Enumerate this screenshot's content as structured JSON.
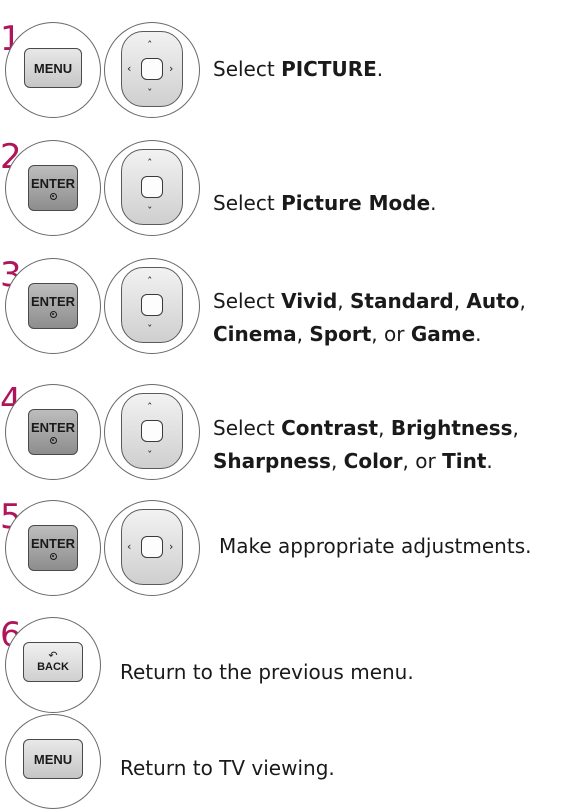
{
  "steps": [
    {
      "number": "1",
      "button": "MENU",
      "nav_arrows": [
        "up",
        "down",
        "left",
        "right"
      ],
      "text": [
        {
          "t": "Select "
        },
        {
          "t": "PICTURE",
          "b": true
        },
        {
          "t": "."
        }
      ]
    },
    {
      "number": "2",
      "button": "ENTER",
      "nav_arrows": [
        "up",
        "down"
      ],
      "text": [
        {
          "t": "Select "
        },
        {
          "t": "Picture Mode",
          "b": true
        },
        {
          "t": "."
        }
      ]
    },
    {
      "number": "3",
      "button": "ENTER",
      "nav_arrows": [
        "up",
        "down"
      ],
      "lines": [
        [
          {
            "t": "Select "
          },
          {
            "t": "Vivid",
            "b": true
          },
          {
            "t": ", "
          },
          {
            "t": "Standard",
            "b": true
          },
          {
            "t": ", "
          },
          {
            "t": "Auto",
            "b": true
          },
          {
            "t": ","
          }
        ],
        [
          {
            "t": "Cinema",
            "b": true
          },
          {
            "t": ", "
          },
          {
            "t": "Sport",
            "b": true
          },
          {
            "t": ", or "
          },
          {
            "t": "Game",
            "b": true
          },
          {
            "t": "."
          }
        ]
      ]
    },
    {
      "number": "4",
      "button": "ENTER",
      "nav_arrows": [
        "up",
        "down"
      ],
      "lines": [
        [
          {
            "t": "Select "
          },
          {
            "t": "Contrast",
            "b": true
          },
          {
            "t": ", "
          },
          {
            "t": "Brightness",
            "b": true
          },
          {
            "t": ","
          }
        ],
        [
          {
            "t": "Sharpness",
            "b": true
          },
          {
            "t": ", "
          },
          {
            "t": "Color",
            "b": true
          },
          {
            "t": ", or "
          },
          {
            "t": "Tint",
            "b": true
          },
          {
            "t": "."
          }
        ]
      ]
    },
    {
      "number": "5",
      "button": "ENTER",
      "nav_arrows": [
        "left",
        "right"
      ],
      "text": [
        {
          "t": "Make appropriate adjustments."
        }
      ]
    },
    {
      "number": "6",
      "button": "BACK",
      "text": [
        {
          "t": "Return to the previous menu."
        }
      ]
    },
    {
      "number": "",
      "button": "MENU",
      "text": [
        {
          "t": "Return to TV viewing."
        }
      ]
    }
  ],
  "colors": {
    "step_number": "#b0145a",
    "text": "#1a1a1a"
  }
}
